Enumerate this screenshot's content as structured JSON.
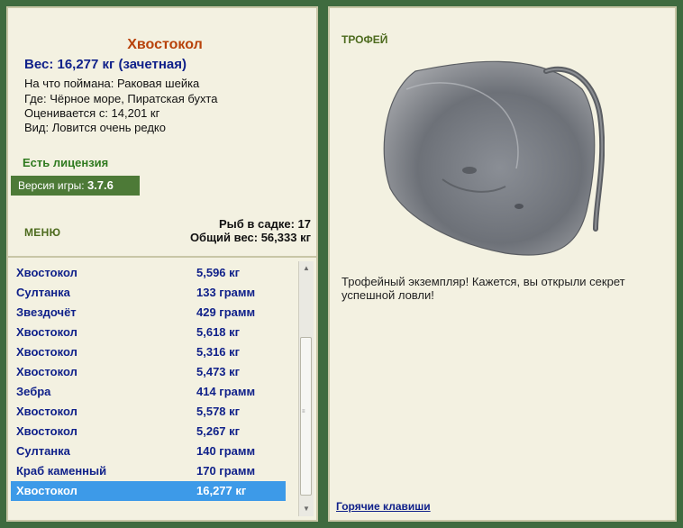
{
  "fish": {
    "name": "Хвостокол",
    "weight": "Вес: 16,277 кг (зачетная)",
    "bait": "На что поймана: Раковая шейка",
    "location": "Где: Чёрное море, Пиратская бухта",
    "value": "Оценивается с: 14,201 кг",
    "rarity": "Вид: Ловится очень редко"
  },
  "license": "Есть лицензия",
  "version": {
    "label": "Версия игры:",
    "value": "3.7.6"
  },
  "menu_label": "МЕНЮ",
  "stats": {
    "count": "Рыб в садке: 17",
    "total": "Общий вес: 56,333 кг"
  },
  "catch": [
    {
      "name": "Хвостокол",
      "weight": "5,596 кг"
    },
    {
      "name": "Султанка",
      "weight": "133 грамм"
    },
    {
      "name": "Звездочёт",
      "weight": "429 грамм"
    },
    {
      "name": "Хвостокол",
      "weight": "5,618 кг"
    },
    {
      "name": "Хвостокол",
      "weight": "5,316 кг"
    },
    {
      "name": "Хвостокол",
      "weight": "5,473 кг"
    },
    {
      "name": "Зебра",
      "weight": "414 грамм"
    },
    {
      "name": "Хвостокол",
      "weight": "5,578 кг"
    },
    {
      "name": "Хвостокол",
      "weight": "5,267 кг"
    },
    {
      "name": "Султанка",
      "weight": "140 грамм"
    },
    {
      "name": "Краб каменный",
      "weight": "170 грамм"
    },
    {
      "name": "Хвостокол",
      "weight": "16,277 кг",
      "selected": true
    }
  ],
  "trophy": {
    "label": "ТРОФЕЙ",
    "text": "Трофейный экземпляр! Кажется, вы открыли секрет успешной ловли!"
  },
  "hotkeys_label": "Горячие клавиши",
  "colors": {
    "background": "#3f6b3f",
    "panel": "#f3f1e1",
    "title": "#b8420a",
    "text_blue": "#10218a",
    "license_green": "#2f7a1f",
    "version_bar": "#4d7a37",
    "selection": "#3d9ae8"
  }
}
